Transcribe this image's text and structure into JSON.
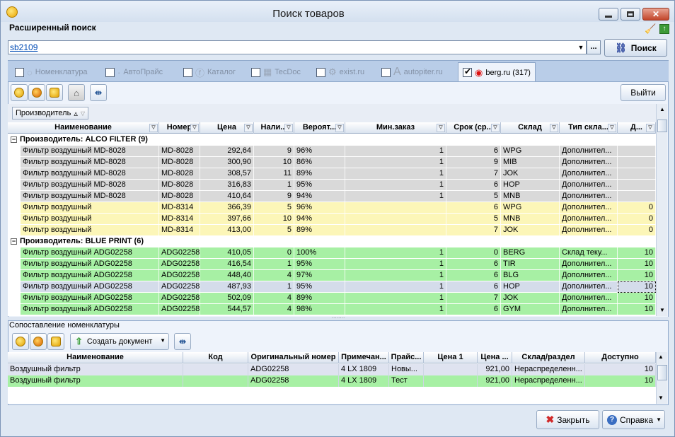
{
  "window": {
    "title": "Поиск товаров"
  },
  "header": {
    "section_title": "Расширенный поиск"
  },
  "search": {
    "value": "sb2109",
    "ellipsis": "...",
    "button_label": "Поиск"
  },
  "tabs": [
    {
      "label": "Номенклатура",
      "checked": false
    },
    {
      "label": "АвтоПрайс",
      "checked": false
    },
    {
      "label": "Каталог",
      "checked": false
    },
    {
      "label": "TecDoc",
      "checked": false
    },
    {
      "label": "exist.ru",
      "checked": false
    },
    {
      "label": "autopiter.ru",
      "checked": false
    },
    {
      "label": "berg.ru (317)",
      "checked": true
    }
  ],
  "toolbar": {
    "exit_label": "Выйти"
  },
  "grouping": {
    "chip_label": "Производитель",
    "sort_glyph": "▵"
  },
  "grid": {
    "columns": [
      "Наименование",
      "Номер",
      "Цена",
      "Нали...",
      "Вероят...",
      "Мин.заказ",
      "Срок (ср...",
      "Склад",
      "Тип скла...",
      "Д..."
    ],
    "groups": [
      {
        "title": "Производитель: ALCO FILTER (9)",
        "rows": [
          {
            "style": "grey",
            "cells": [
              "Фильтр воздушный MD-8028",
              "MD-8028",
              "292,64",
              "9",
              "96%",
              "1",
              "6",
              "WPG",
              "Дополнител...",
              ""
            ]
          },
          {
            "style": "grey",
            "cells": [
              "Фильтр воздушный MD-8028",
              "MD-8028",
              "300,90",
              "10",
              "86%",
              "1",
              "9",
              "MIB",
              "Дополнител...",
              ""
            ]
          },
          {
            "style": "grey",
            "cells": [
              "Фильтр воздушный MD-8028",
              "MD-8028",
              "308,57",
              "11",
              "89%",
              "1",
              "7",
              "JOK",
              "Дополнител...",
              ""
            ]
          },
          {
            "style": "grey",
            "cells": [
              "Фильтр воздушный MD-8028",
              "MD-8028",
              "316,83",
              "1",
              "95%",
              "1",
              "6",
              "HOP",
              "Дополнител...",
              ""
            ]
          },
          {
            "style": "grey",
            "cells": [
              "Фильтр воздушный MD-8028",
              "MD-8028",
              "410,64",
              "9",
              "94%",
              "1",
              "5",
              "MNB",
              "Дополнител...",
              ""
            ]
          },
          {
            "style": "yellow",
            "cells": [
              "Фильтр воздушный",
              "MD-8314",
              "366,39",
              "5",
              "96%",
              "",
              "6",
              "WPG",
              "Дополнител...",
              "0"
            ]
          },
          {
            "style": "yellow",
            "cells": [
              "Фильтр воздушный",
              "MD-8314",
              "397,66",
              "10",
              "94%",
              "",
              "5",
              "MNB",
              "Дополнител...",
              "0"
            ]
          },
          {
            "style": "yellow",
            "cells": [
              "Фильтр воздушный",
              "MD-8314",
              "413,00",
              "5",
              "89%",
              "",
              "7",
              "JOK",
              "Дополнител...",
              "0"
            ]
          }
        ]
      },
      {
        "title": "Производитель: BLUE PRINT (6)",
        "rows": [
          {
            "style": "green",
            "cells": [
              "Фильтр воздушный ADG02258",
              "ADG02258",
              "410,05",
              "0",
              "100%",
              "1",
              "0",
              "BERG",
              "Склад теку...",
              "10"
            ]
          },
          {
            "style": "green",
            "cells": [
              "Фильтр воздушный ADG02258",
              "ADG02258",
              "416,54",
              "1",
              "95%",
              "1",
              "6",
              "TIR",
              "Дополнител...",
              "10"
            ]
          },
          {
            "style": "green",
            "cells": [
              "Фильтр воздушный ADG02258",
              "ADG02258",
              "448,40",
              "4",
              "97%",
              "1",
              "6",
              "BLG",
              "Дополнител...",
              "10"
            ]
          },
          {
            "style": "sel",
            "cells": [
              "Фильтр воздушный ADG02258",
              "ADG02258",
              "487,93",
              "1",
              "95%",
              "1",
              "6",
              "HOP",
              "Дополнител...",
              "10"
            ]
          },
          {
            "style": "green",
            "cells": [
              "Фильтр воздушный ADG02258",
              "ADG02258",
              "502,09",
              "4",
              "89%",
              "1",
              "7",
              "JOK",
              "Дополнител...",
              "10"
            ]
          },
          {
            "style": "green",
            "cells": [
              "Фильтр воздушный ADG02258",
              "ADG02258",
              "544,57",
              "4",
              "98%",
              "1",
              "6",
              "GYM",
              "Дополнител...",
              "10"
            ]
          }
        ]
      }
    ]
  },
  "lower": {
    "title": "Сопоставление номенклатуры",
    "create_doc_label": "Создать документ",
    "columns": [
      "Наименование",
      "Код",
      "Оригинальный номер",
      "Примечан...",
      "Прайс...",
      "Цена 1",
      "Цена ...",
      "Склад/раздел",
      "Доступно"
    ],
    "rows": [
      {
        "style": "lav",
        "cells": [
          "Воздушный фильтр",
          "",
          "ADG02258",
          "4 LX 1809",
          "Новы...",
          "",
          "921,00",
          "Нераспределенн...",
          "10"
        ]
      },
      {
        "style": "green",
        "cells": [
          "Воздушный фильтр",
          "",
          "ADG02258",
          "4 LX 1809",
          "Тест",
          "",
          "921,00",
          "Нераспределенн...",
          "10"
        ]
      }
    ]
  },
  "footer": {
    "close_label": "Закрыть",
    "help_label": "Справка"
  }
}
